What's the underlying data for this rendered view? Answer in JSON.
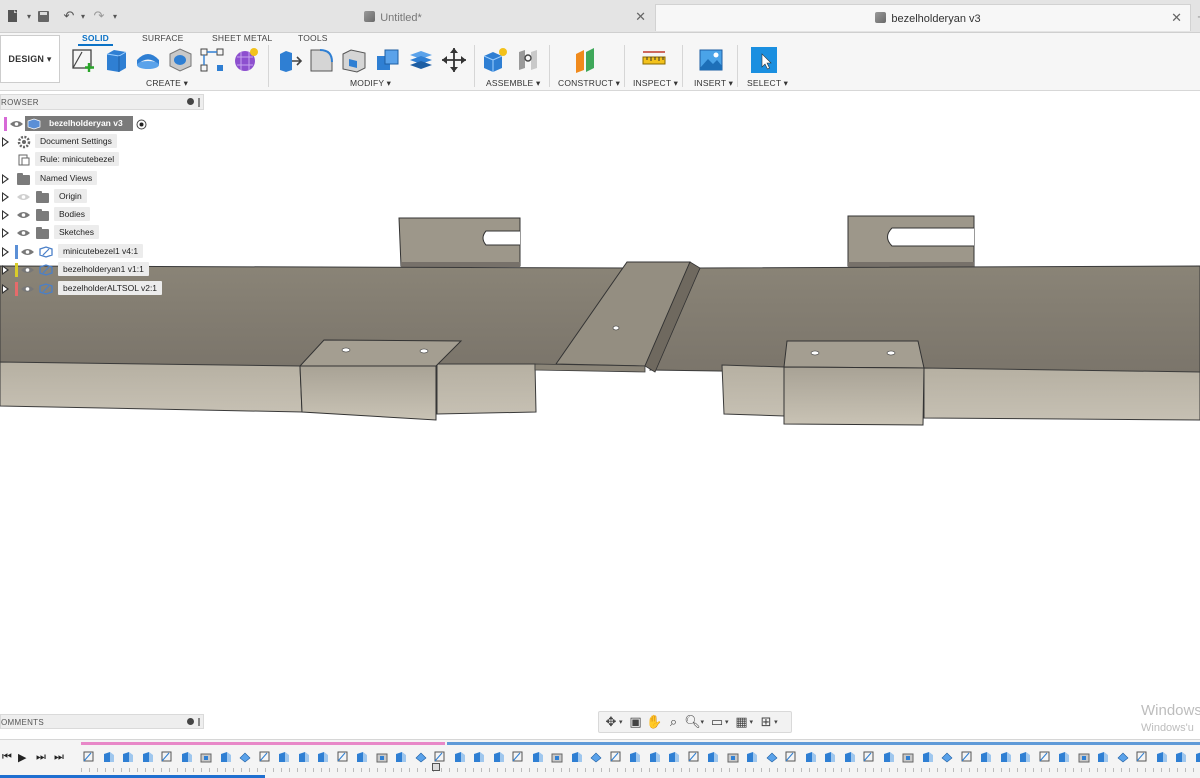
{
  "tabs": [
    {
      "title": "Untitled*",
      "active": false
    },
    {
      "title": "bezelholderyan v3",
      "active": true
    }
  ],
  "toolbar": {
    "design_label": "DESIGN",
    "workspace_tabs": [
      "SOLID",
      "SURFACE",
      "SHEET METAL",
      "TOOLS"
    ],
    "groups": {
      "create": "CREATE",
      "modify": "MODIFY",
      "assemble": "ASSEMBLE",
      "construct": "CONSTRUCT",
      "inspect": "INSPECT",
      "insert": "INSERT",
      "select": "SELECT"
    }
  },
  "browser": {
    "title": "ROWSER",
    "root": "bezelholderyan v3",
    "items": [
      {
        "label": "Document Settings",
        "icon": "gear-icon"
      },
      {
        "label": "Rule: minicutebezel",
        "icon": "rule-icon"
      },
      {
        "label": "Named Views",
        "icon": "folder-icon"
      },
      {
        "label": "Origin",
        "icon": "folder-icon"
      },
      {
        "label": "Bodies",
        "icon": "folder-icon"
      },
      {
        "label": "Sketches",
        "icon": "folder-icon"
      },
      {
        "label": "minicutebezel1 v4:1",
        "icon": "component-icon",
        "color": "#5b8fd6"
      },
      {
        "label": "bezelholderyan1 v1:1",
        "icon": "component-icon",
        "color": "#d9cc2a"
      },
      {
        "label": "bezelholderALTSOL v2:1",
        "icon": "component-icon",
        "color": "#e66b6b"
      }
    ]
  },
  "comments": {
    "title": "OMMENTS"
  },
  "watermark": {
    "line1": "Windows",
    "line2": "Windows'u"
  },
  "colors": {
    "accent": "#0b72c6",
    "select_button": "#1a8fe0",
    "metal": "#8c857a",
    "timeline_a": "#e888c8",
    "timeline_b": "#5f9ad8"
  }
}
